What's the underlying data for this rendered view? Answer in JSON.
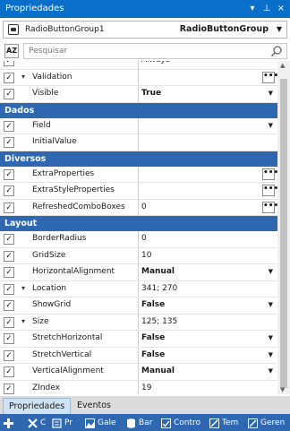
{
  "panel": {
    "title": "Propriedades"
  },
  "selector": {
    "name": "RadioButtonGroup1",
    "type": "RadioButtonGroup"
  },
  "search": {
    "placeholder": "Pesquisar"
  },
  "rows": [
    {
      "kind": "prop",
      "name": "",
      "value": "Always",
      "checked": true
    },
    {
      "kind": "prop",
      "name": "Validation",
      "value": "",
      "checked": true,
      "expander": "expanded",
      "ellipsis": true
    },
    {
      "kind": "prop",
      "name": "Visible",
      "value": "True",
      "checked": true,
      "bold": true,
      "dropdown": true
    },
    {
      "kind": "cat",
      "name": "Dados"
    },
    {
      "kind": "prop",
      "name": "Field",
      "value": "",
      "checked": true,
      "dropdown": true
    },
    {
      "kind": "prop",
      "name": "InitialValue",
      "value": "",
      "checked": true
    },
    {
      "kind": "cat",
      "name": "Diversos"
    },
    {
      "kind": "prop",
      "name": "ExtraProperties",
      "value": "",
      "checked": true,
      "ellipsis": true
    },
    {
      "kind": "prop",
      "name": "ExtraStyleProperties",
      "value": "",
      "checked": true,
      "ellipsis": true
    },
    {
      "kind": "prop",
      "name": "RefreshedComboBoxes",
      "value": "0",
      "checked": true,
      "ellipsis": true
    },
    {
      "kind": "cat",
      "name": "Layout"
    },
    {
      "kind": "prop",
      "name": "BorderRadius",
      "value": "0",
      "checked": true
    },
    {
      "kind": "prop",
      "name": "GridSize",
      "value": "10",
      "checked": true
    },
    {
      "kind": "prop",
      "name": "HorizontalAlignment",
      "value": "Manual",
      "checked": true,
      "bold": true,
      "dropdown": true
    },
    {
      "kind": "prop",
      "name": "Location",
      "value": "341; 270",
      "checked": true,
      "expander": "expanded"
    },
    {
      "kind": "prop",
      "name": "ShowGrid",
      "value": "False",
      "checked": true,
      "bold": true,
      "dropdown": true
    },
    {
      "kind": "prop",
      "name": "Size",
      "value": "125; 135",
      "checked": true,
      "expander": "expanded"
    },
    {
      "kind": "prop",
      "name": "StretchHorizontal",
      "value": "False",
      "checked": true,
      "bold": true,
      "dropdown": true
    },
    {
      "kind": "prop",
      "name": "StretchVertical",
      "value": "False",
      "checked": true,
      "bold": true,
      "dropdown": true
    },
    {
      "kind": "prop",
      "name": "VerticalAlignment",
      "value": "Manual",
      "checked": true,
      "bold": true,
      "dropdown": true
    },
    {
      "kind": "prop",
      "name": "ZIndex",
      "value": "19",
      "checked": true
    }
  ],
  "tabs": [
    {
      "label": "Propriedades",
      "active": true
    },
    {
      "label": "Eventos",
      "active": false
    }
  ],
  "toolbar": {
    "items": [
      {
        "label": "",
        "icon": "plus-icon"
      },
      {
        "label": "C",
        "icon": "tools-icon"
      },
      {
        "label": "Pr",
        "icon": "properties-icon"
      },
      {
        "label": "Gale",
        "icon": "gallery-icon"
      },
      {
        "label": "Bar",
        "icon": "database-icon"
      },
      {
        "label": "Contro",
        "icon": "controls-icon"
      },
      {
        "label": "Tem",
        "icon": "theme-icon"
      },
      {
        "label": "Geren",
        "icon": "manager-icon"
      }
    ]
  },
  "colors": {
    "titlebar": "#0a6fc8",
    "category": "#2f68b0",
    "tab_active": "#cfe3f3"
  }
}
